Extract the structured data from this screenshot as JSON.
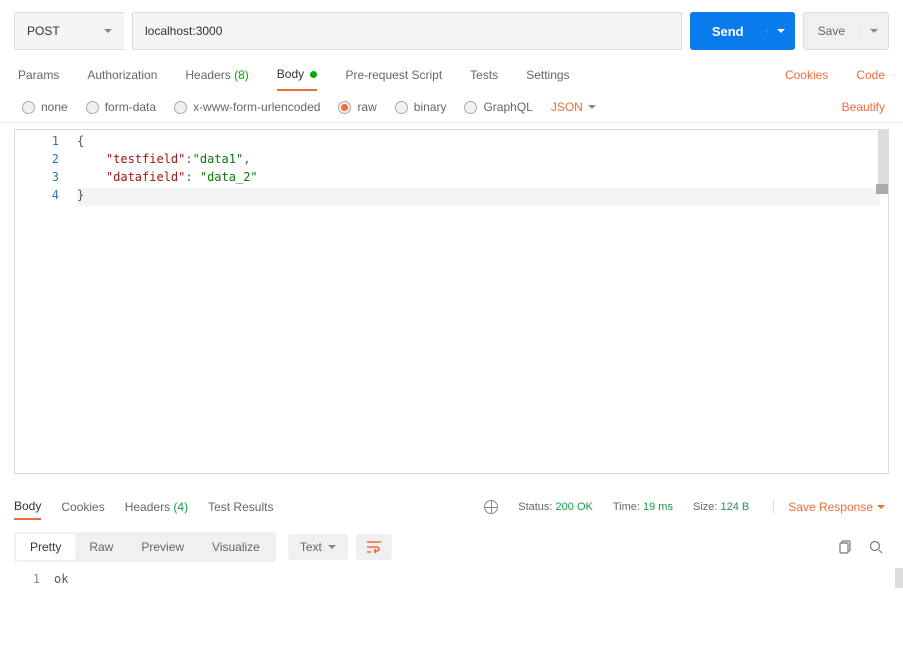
{
  "request": {
    "method": "POST",
    "url": "localhost:3000",
    "send": "Send",
    "save": "Save"
  },
  "tabs": {
    "params": "Params",
    "authorization": "Authorization",
    "headers": "Headers",
    "headers_count": "(8)",
    "body": "Body",
    "prerequest": "Pre-request Script",
    "tests": "Tests",
    "settings": "Settings",
    "cookies": "Cookies",
    "code": "Code"
  },
  "body_types": {
    "none": "none",
    "formdata": "form-data",
    "urlencoded": "x-www-form-urlencoded",
    "raw": "raw",
    "binary": "binary",
    "graphql": "GraphQL",
    "format": "JSON",
    "beautify": "Beautify"
  },
  "editor": {
    "l1": "{",
    "l2a": "\"testfield\"",
    "l2b": ":",
    "l2c": "\"data1\"",
    "l2d": ",",
    "l3a": "\"datafield\"",
    "l3b": ": ",
    "l3c": "\"data_2\"",
    "l4": "}"
  },
  "response": {
    "body": "Body",
    "cookies": "Cookies",
    "headers": "Headers",
    "headers_count": "(4)",
    "tests": "Test Results",
    "status_label": "Status:",
    "status_val": "200 OK",
    "time_label": "Time:",
    "time_val": "19 ms",
    "size_label": "Size:",
    "size_val": "124 B",
    "save": "Save Response"
  },
  "response_toolbar": {
    "pretty": "Pretty",
    "raw": "Raw",
    "preview": "Preview",
    "visualize": "Visualize",
    "format": "Text"
  },
  "response_body": {
    "line1": "ok"
  }
}
